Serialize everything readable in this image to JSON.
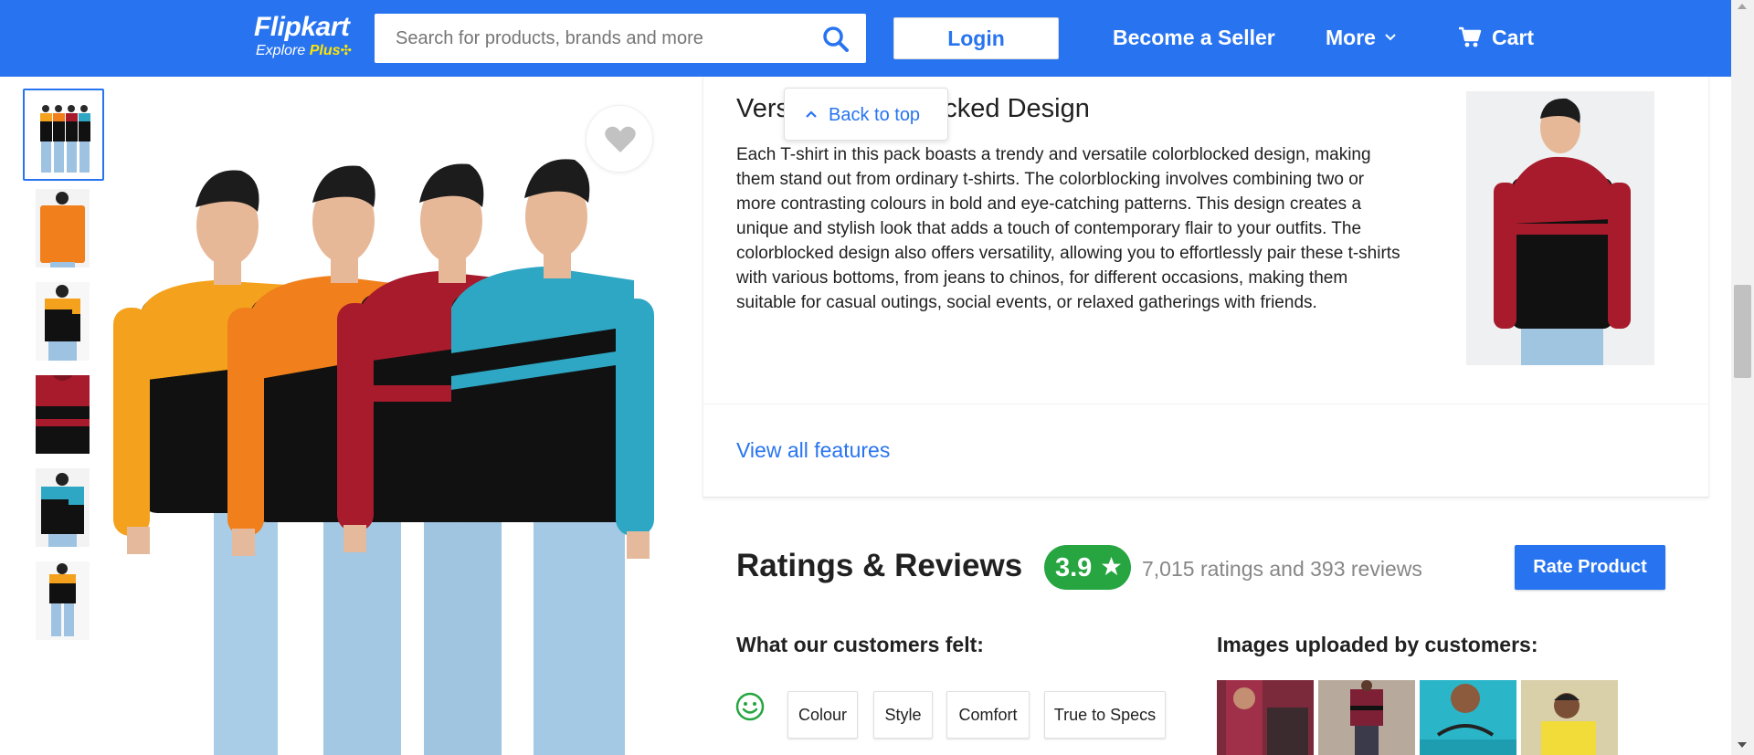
{
  "header": {
    "logo_main": "Flipkart",
    "logo_explore": "Explore",
    "logo_plus": "Plus",
    "search_placeholder": "Search for products, brands and more",
    "login_label": "Login",
    "seller_label": "Become a Seller",
    "more_label": "More",
    "cart_label": "Cart"
  },
  "colors": {
    "brand": "#2874f0",
    "rating_green": "#26a541",
    "text_grey": "#878787"
  },
  "gallery": {
    "thumb_count": 6,
    "selected_index": 0,
    "wishlist_icon": "heart-icon"
  },
  "feature": {
    "title": "Versatile Colorblocked Design",
    "description": "Each T-shirt in this pack boasts a trendy and versatile colorblocked design, making them stand out from ordinary t-shirts. The colorblocking involves combining two or more contrasting colours in bold and eye-catching patterns. This design creates a unique and stylish look that adds a touch of contemporary flair to your outfits. The colorblocked design also offers versatility, allowing you to effortlessly pair these t-shirts with various bottoms, from jeans to chinos, for different occasions, making them suitable for casual outings, social events, or relaxed gatherings with friends.",
    "view_all": "View all features"
  },
  "back_to_top": "Back to top",
  "ratings": {
    "title": "Ratings & Reviews",
    "value": "3.9",
    "count_text": "7,015 ratings and 393 reviews",
    "rate_button": "Rate Product",
    "felt_title": "What our customers felt:",
    "chips": [
      "Colour",
      "Style",
      "Comfort",
      "True to Specs"
    ],
    "images_title": "Images uploaded by customers:"
  }
}
